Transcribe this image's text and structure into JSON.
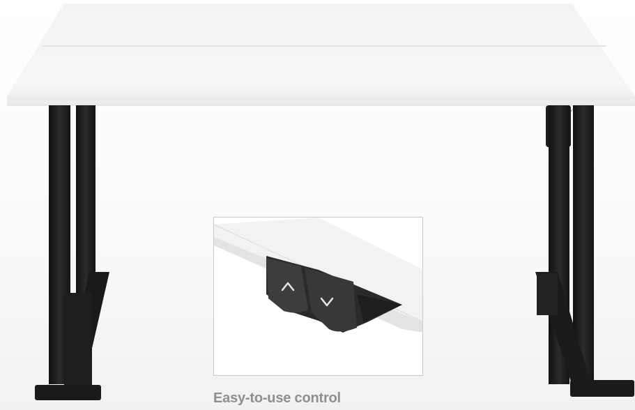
{
  "caption": "Easy-to-use control",
  "controller": {
    "up_icon": "chevron-up-icon",
    "down_icon": "chevron-down-icon"
  },
  "colors": {
    "desktop": "#f6f6f6",
    "frame": "#1f1f1f",
    "caption": "#8f8f8f"
  }
}
